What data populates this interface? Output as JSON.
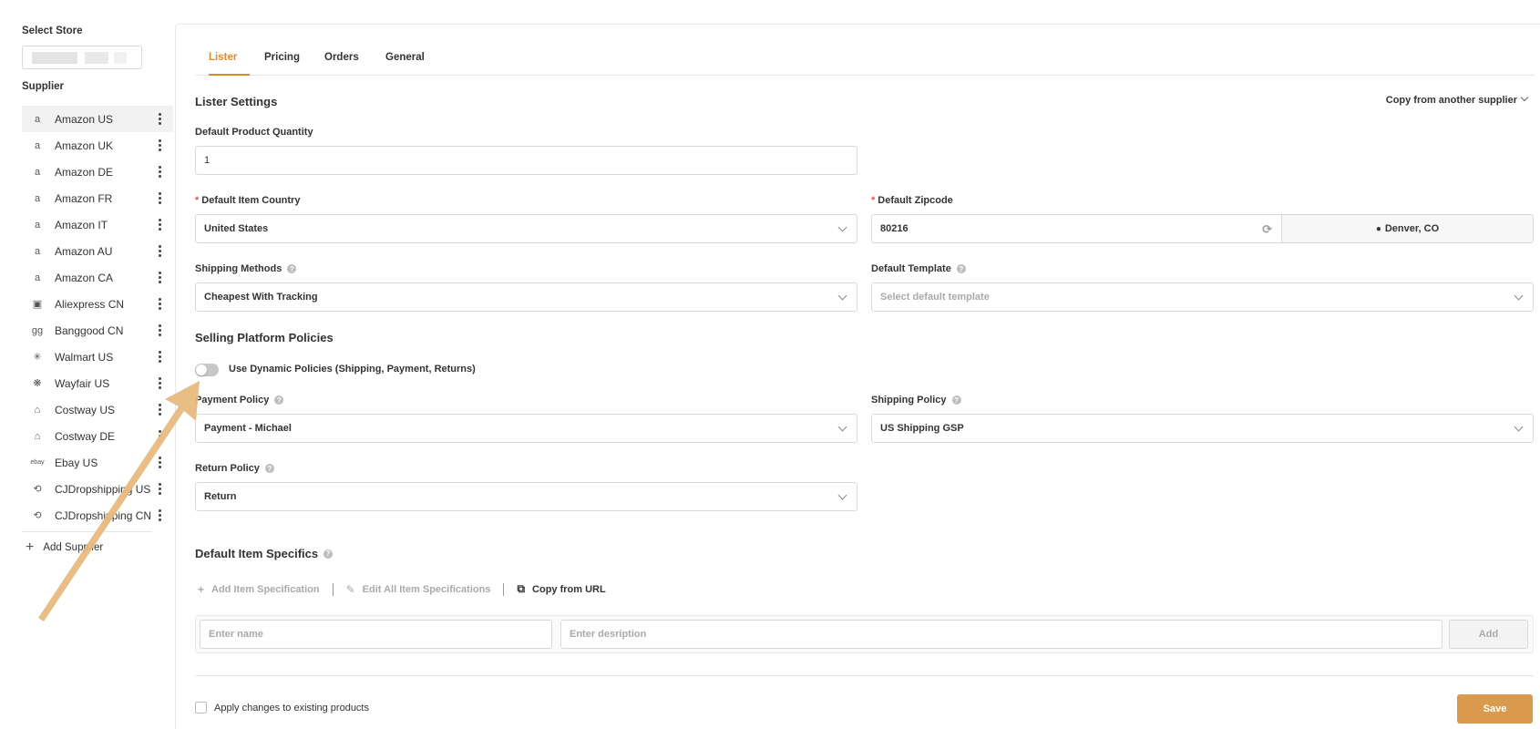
{
  "sidebar": {
    "select_store_label": "Select Store",
    "supplier_heading": "Supplier",
    "add_supplier_label": "Add Supplier",
    "suppliers": [
      {
        "label": "Amazon US",
        "icon": "amazon-icon",
        "active": true
      },
      {
        "label": "Amazon UK",
        "icon": "amazon-icon"
      },
      {
        "label": "Amazon DE",
        "icon": "amazon-icon"
      },
      {
        "label": "Amazon FR",
        "icon": "amazon-icon"
      },
      {
        "label": "Amazon IT",
        "icon": "amazon-icon"
      },
      {
        "label": "Amazon AU",
        "icon": "amazon-icon"
      },
      {
        "label": "Amazon CA",
        "icon": "amazon-icon"
      },
      {
        "label": "Aliexpress CN",
        "icon": "aliexpress-icon"
      },
      {
        "label": "Banggood CN",
        "icon": "banggood-icon"
      },
      {
        "label": "Walmart US",
        "icon": "walmart-icon"
      },
      {
        "label": "Wayfair US",
        "icon": "wayfair-icon"
      },
      {
        "label": "Costway US",
        "icon": "costway-icon"
      },
      {
        "label": "Costway DE",
        "icon": "costway-icon"
      },
      {
        "label": "Ebay US",
        "icon": "ebay-icon"
      },
      {
        "label": "CJDropshipping US",
        "icon": "cjdropshipping-icon"
      },
      {
        "label": "CJDropshipping CN",
        "icon": "cjdropshipping-icon"
      }
    ]
  },
  "tabs": [
    {
      "label": "Lister",
      "active": true
    },
    {
      "label": "Pricing"
    },
    {
      "label": "Orders"
    },
    {
      "label": "General"
    }
  ],
  "lister": {
    "title": "Lister Settings",
    "copy_from_label": "Copy from another supplier",
    "default_quantity": {
      "label": "Default Product Quantity",
      "value": "1"
    },
    "item_country": {
      "label": "Default Item Country",
      "value": "United States"
    },
    "zipcode": {
      "label": "Default Zipcode",
      "value": "80216",
      "location": "Denver, CO"
    },
    "shipping_methods": {
      "label": "Shipping Methods",
      "value": "Cheapest With Tracking"
    },
    "default_template": {
      "label": "Default Template",
      "placeholder": "Select default template"
    }
  },
  "policies": {
    "title": "Selling Platform Policies",
    "toggle_label": "Use Dynamic Policies (Shipping, Payment, Returns)",
    "toggle_on": false,
    "payment": {
      "label": "Payment Policy",
      "value": "Payment - Michael"
    },
    "shipping": {
      "label": "Shipping Policy",
      "value": "US Shipping GSP"
    },
    "return": {
      "label": "Return Policy",
      "value": "Return"
    }
  },
  "item_specifics": {
    "title": "Default Item Specifics",
    "add_spec_label": "Add Item Specification",
    "edit_all_label": "Edit All Item Specifications",
    "copy_url_label": "Copy from URL",
    "name_placeholder": "Enter name",
    "description_placeholder": "Enter desription",
    "add_button": "Add"
  },
  "footer": {
    "apply_label": "Apply changes to existing products",
    "save_label": "Save"
  },
  "colors": {
    "accent": "#d98b2b",
    "save_button": "#d99a4e",
    "annotation_arrow": "#e8b980"
  }
}
